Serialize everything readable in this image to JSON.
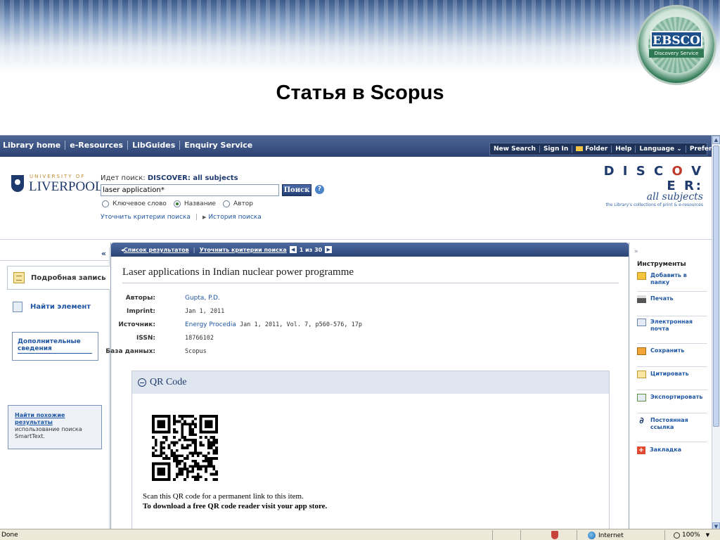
{
  "slide": {
    "title": "Статья в Scopus",
    "logo": {
      "brand": "EBSCO",
      "subtitle": "Discovery Service"
    }
  },
  "topnav": {
    "links": [
      "Library home",
      "e-Resources",
      "LibGuides",
      "Enquiry Service"
    ],
    "utility": [
      "New Search",
      "Sign In",
      "Folder",
      "Help",
      "Language",
      "Preferences"
    ]
  },
  "header": {
    "institution_top": "UNIVERSITY OF",
    "institution_name": "LIVERPOOL",
    "search_label_prefix": "Идет поиск:",
    "search_label_scope": "DISCOVER: all subjects",
    "search_value": "laser application*",
    "search_button": "Поиск",
    "modes": [
      "Ключевое слово",
      "Название",
      "Автор"
    ],
    "selected_mode": "Название",
    "refine_link": "Уточнить критерии поиска",
    "history_link": "История поиска",
    "discover_word": "DISCOVER:",
    "discover_subjects": "all subjects",
    "discover_tagline": "the Library's collections of print & e-resources"
  },
  "left_sidebar": {
    "detail_tab": "Подробная запись",
    "find_item": "Найти элемент",
    "more_info": "Дополнительные сведения",
    "similar_title": "Найти похожие результаты",
    "similar_desc": "использование поиска SmartText."
  },
  "results_bar": {
    "back_link": "Список результатов",
    "refine_link": "Уточнить критерии поиска",
    "position": "1 из 30"
  },
  "record": {
    "title": "Laser applications in Indian nuclear power programme",
    "fields": [
      {
        "label": "Авторы:",
        "value_link": "Gupta, P.D.",
        "value": ""
      },
      {
        "label": "Imprint:",
        "value_link": "",
        "value": "Jan 1, 2011"
      },
      {
        "label": "Источник:",
        "value_link": "Energy Procedia",
        "value": "Jan 1, 2011, Vol. 7, p560-576, 17p"
      },
      {
        "label": "ISSN:",
        "value_link": "",
        "value": "18766102"
      },
      {
        "label": "База данных:",
        "value_link": "",
        "value": "Scopus"
      }
    ]
  },
  "qr": {
    "heading": "QR Code",
    "line1": "Scan this QR code for a permanent link to this item.",
    "line2": "To download a free QR code reader visit your app store."
  },
  "tools": {
    "heading": "Инструменты",
    "items": [
      {
        "label": "Добавить в папку",
        "icon": "folder-icon"
      },
      {
        "label": "Печать",
        "icon": "print-icon"
      },
      {
        "label": "Электронная почта",
        "icon": "email-icon"
      },
      {
        "label": "Сохранить",
        "icon": "save-icon"
      },
      {
        "label": "Цитировать",
        "icon": "cite-icon"
      },
      {
        "label": "Экспортировать",
        "icon": "export-icon"
      },
      {
        "label": "Постоянная ссылка",
        "icon": "permalink-icon"
      },
      {
        "label": "Закладка",
        "icon": "bookmark-icon"
      }
    ]
  },
  "statusbar": {
    "status": "Done",
    "zone": "Internet",
    "zoom": "100%"
  }
}
